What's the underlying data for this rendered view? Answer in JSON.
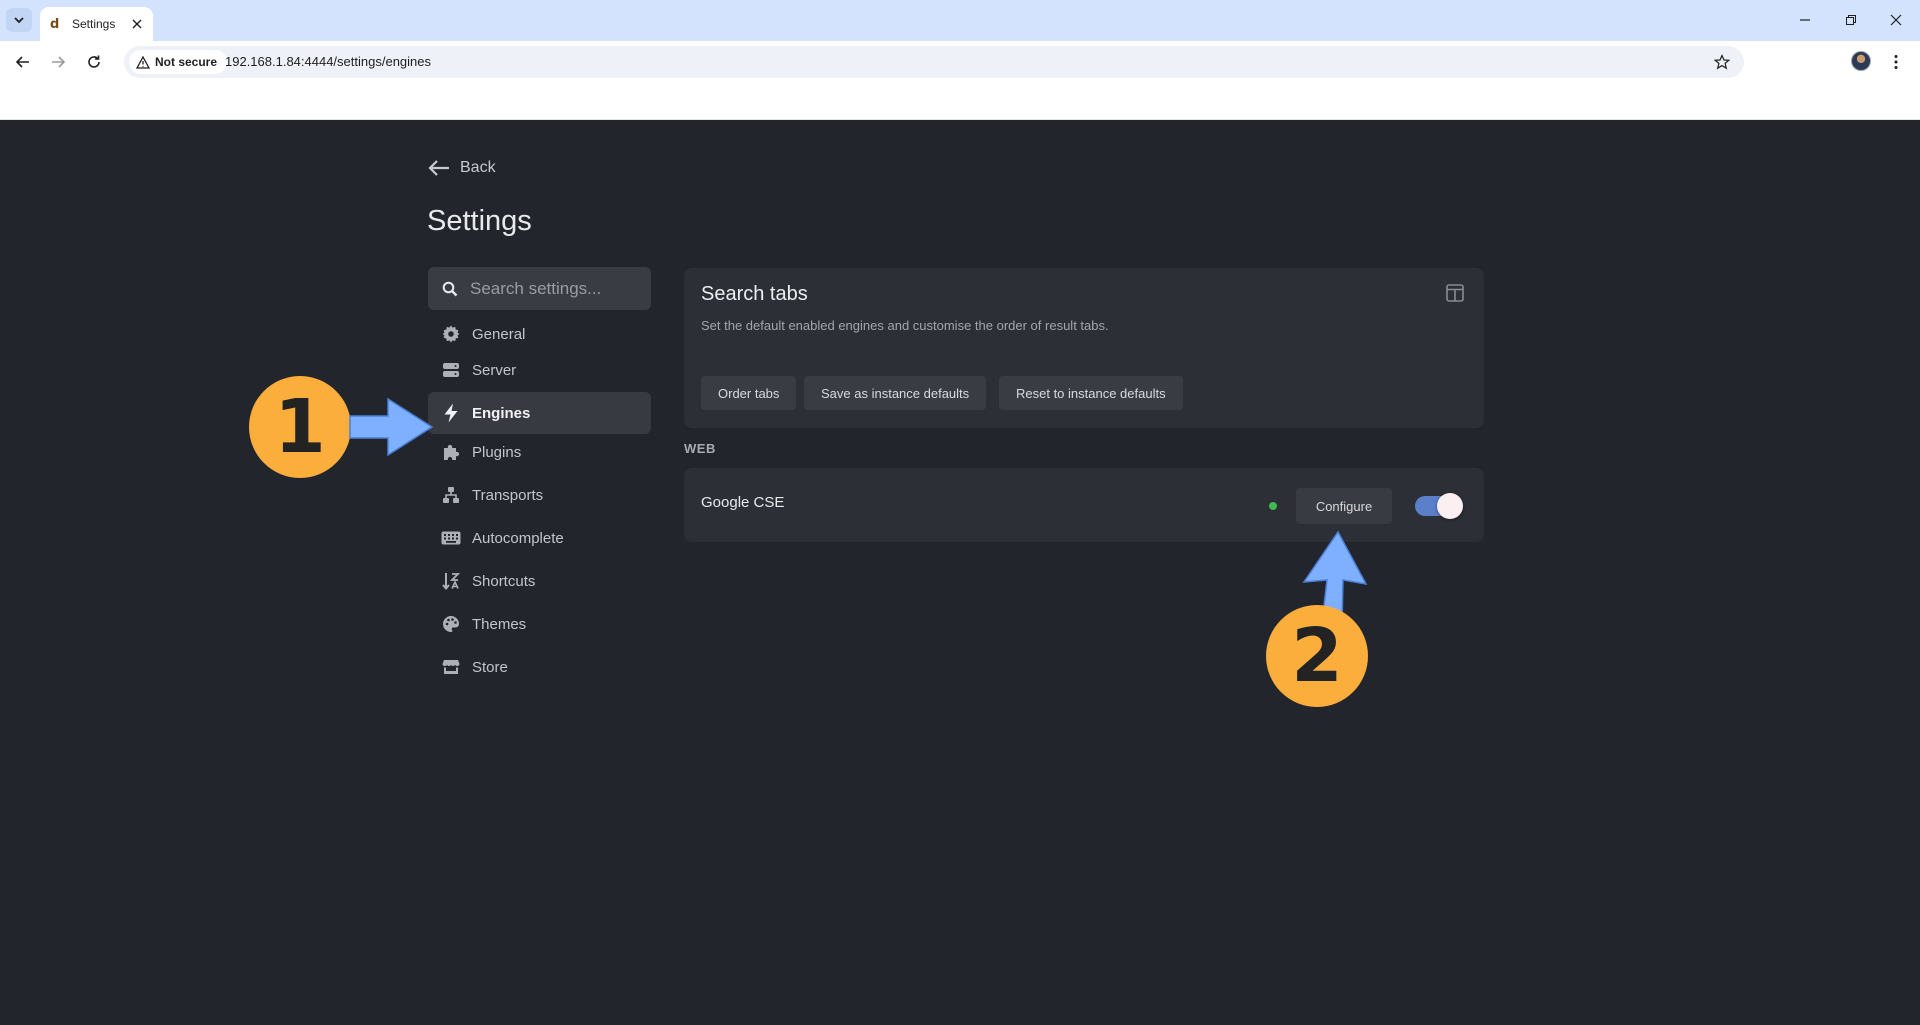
{
  "browser": {
    "tab_title": "Settings",
    "tab_favicon": "d",
    "security_label": "Not secure",
    "url": "192.168.1.84:4444/settings/engines"
  },
  "page": {
    "back_label": "Back",
    "title": "Settings",
    "search_placeholder": "Search settings...",
    "sidebar": [
      {
        "label": "General",
        "icon": "gear-icon"
      },
      {
        "label": "Server",
        "icon": "server-icon"
      },
      {
        "label": "Engines",
        "icon": "lightning-icon",
        "active": true
      },
      {
        "label": "Plugins",
        "icon": "puzzle-icon"
      },
      {
        "label": "Transports",
        "icon": "network-icon"
      },
      {
        "label": "Autocomplete",
        "icon": "keyboard-icon"
      },
      {
        "label": "Shortcuts",
        "icon": "sort-icon"
      },
      {
        "label": "Themes",
        "icon": "palette-icon"
      },
      {
        "label": "Store",
        "icon": "store-icon"
      }
    ],
    "search_tabs": {
      "title": "Search tabs",
      "description": "Set the default enabled engines and customise the order of result tabs.",
      "buttons": [
        "Order tabs",
        "Save as instance defaults",
        "Reset to instance defaults"
      ]
    },
    "section_label": "WEB",
    "engine": {
      "name": "Google CSE",
      "status_color": "#3fb950",
      "configure_label": "Configure",
      "enabled": true
    }
  },
  "annotations": {
    "step1": "1",
    "step2": "2",
    "color": "#fbae3c",
    "arrow_color": "#7fb0ff"
  }
}
